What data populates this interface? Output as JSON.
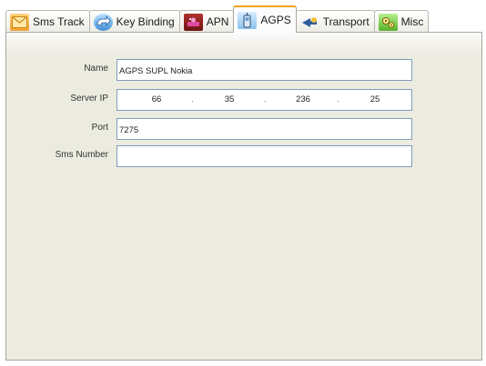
{
  "tabs": [
    {
      "label": "Sms Track",
      "icon": "envelope-icon",
      "active": false
    },
    {
      "label": "Key Binding",
      "icon": "keyboard-icon",
      "active": false
    },
    {
      "label": "APN",
      "icon": "apn-network-icon",
      "active": false
    },
    {
      "label": "AGPS",
      "icon": "phone-antenna-icon",
      "active": true
    },
    {
      "label": "Transport",
      "icon": "transport-arrow-icon",
      "active": false
    },
    {
      "label": "Misc",
      "icon": "gears-icon",
      "active": false
    }
  ],
  "form": {
    "name": {
      "label": "Name",
      "value": "AGPS SUPL Nokia"
    },
    "server_ip": {
      "label": "Server IP",
      "octets": [
        "66",
        "35",
        "236",
        "25"
      ],
      "separator": "."
    },
    "port": {
      "label": "Port",
      "value": "7275"
    },
    "sms_number": {
      "label": "Sms Number",
      "value": ""
    }
  },
  "colors": {
    "active_tab_accent": "#f0a21a",
    "panel_background": "#ecebe0",
    "field_border": "#7f9db9"
  }
}
